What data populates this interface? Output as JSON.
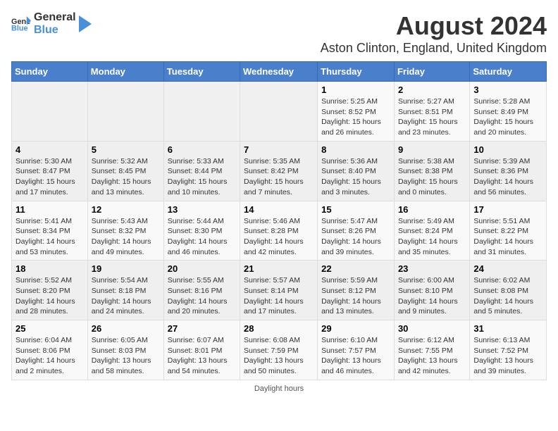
{
  "logo": {
    "text_general": "General",
    "text_blue": "Blue",
    "icon_symbol": "▶"
  },
  "title": "August 2024",
  "subtitle": "Aston Clinton, England, United Kingdom",
  "days_of_week": [
    "Sunday",
    "Monday",
    "Tuesday",
    "Wednesday",
    "Thursday",
    "Friday",
    "Saturday"
  ],
  "weeks": [
    [
      {
        "day": "",
        "info": ""
      },
      {
        "day": "",
        "info": ""
      },
      {
        "day": "",
        "info": ""
      },
      {
        "day": "",
        "info": ""
      },
      {
        "day": "1",
        "info": "Sunrise: 5:25 AM\nSunset: 8:52 PM\nDaylight: 15 hours and 26 minutes."
      },
      {
        "day": "2",
        "info": "Sunrise: 5:27 AM\nSunset: 8:51 PM\nDaylight: 15 hours and 23 minutes."
      },
      {
        "day": "3",
        "info": "Sunrise: 5:28 AM\nSunset: 8:49 PM\nDaylight: 15 hours and 20 minutes."
      }
    ],
    [
      {
        "day": "4",
        "info": "Sunrise: 5:30 AM\nSunset: 8:47 PM\nDaylight: 15 hours and 17 minutes."
      },
      {
        "day": "5",
        "info": "Sunrise: 5:32 AM\nSunset: 8:45 PM\nDaylight: 15 hours and 13 minutes."
      },
      {
        "day": "6",
        "info": "Sunrise: 5:33 AM\nSunset: 8:44 PM\nDaylight: 15 hours and 10 minutes."
      },
      {
        "day": "7",
        "info": "Sunrise: 5:35 AM\nSunset: 8:42 PM\nDaylight: 15 hours and 7 minutes."
      },
      {
        "day": "8",
        "info": "Sunrise: 5:36 AM\nSunset: 8:40 PM\nDaylight: 15 hours and 3 minutes."
      },
      {
        "day": "9",
        "info": "Sunrise: 5:38 AM\nSunset: 8:38 PM\nDaylight: 15 hours and 0 minutes."
      },
      {
        "day": "10",
        "info": "Sunrise: 5:39 AM\nSunset: 8:36 PM\nDaylight: 14 hours and 56 minutes."
      }
    ],
    [
      {
        "day": "11",
        "info": "Sunrise: 5:41 AM\nSunset: 8:34 PM\nDaylight: 14 hours and 53 minutes."
      },
      {
        "day": "12",
        "info": "Sunrise: 5:43 AM\nSunset: 8:32 PM\nDaylight: 14 hours and 49 minutes."
      },
      {
        "day": "13",
        "info": "Sunrise: 5:44 AM\nSunset: 8:30 PM\nDaylight: 14 hours and 46 minutes."
      },
      {
        "day": "14",
        "info": "Sunrise: 5:46 AM\nSunset: 8:28 PM\nDaylight: 14 hours and 42 minutes."
      },
      {
        "day": "15",
        "info": "Sunrise: 5:47 AM\nSunset: 8:26 PM\nDaylight: 14 hours and 39 minutes."
      },
      {
        "day": "16",
        "info": "Sunrise: 5:49 AM\nSunset: 8:24 PM\nDaylight: 14 hours and 35 minutes."
      },
      {
        "day": "17",
        "info": "Sunrise: 5:51 AM\nSunset: 8:22 PM\nDaylight: 14 hours and 31 minutes."
      }
    ],
    [
      {
        "day": "18",
        "info": "Sunrise: 5:52 AM\nSunset: 8:20 PM\nDaylight: 14 hours and 28 minutes."
      },
      {
        "day": "19",
        "info": "Sunrise: 5:54 AM\nSunset: 8:18 PM\nDaylight: 14 hours and 24 minutes."
      },
      {
        "day": "20",
        "info": "Sunrise: 5:55 AM\nSunset: 8:16 PM\nDaylight: 14 hours and 20 minutes."
      },
      {
        "day": "21",
        "info": "Sunrise: 5:57 AM\nSunset: 8:14 PM\nDaylight: 14 hours and 17 minutes."
      },
      {
        "day": "22",
        "info": "Sunrise: 5:59 AM\nSunset: 8:12 PM\nDaylight: 14 hours and 13 minutes."
      },
      {
        "day": "23",
        "info": "Sunrise: 6:00 AM\nSunset: 8:10 PM\nDaylight: 14 hours and 9 minutes."
      },
      {
        "day": "24",
        "info": "Sunrise: 6:02 AM\nSunset: 8:08 PM\nDaylight: 14 hours and 5 minutes."
      }
    ],
    [
      {
        "day": "25",
        "info": "Sunrise: 6:04 AM\nSunset: 8:06 PM\nDaylight: 14 hours and 2 minutes."
      },
      {
        "day": "26",
        "info": "Sunrise: 6:05 AM\nSunset: 8:03 PM\nDaylight: 13 hours and 58 minutes."
      },
      {
        "day": "27",
        "info": "Sunrise: 6:07 AM\nSunset: 8:01 PM\nDaylight: 13 hours and 54 minutes."
      },
      {
        "day": "28",
        "info": "Sunrise: 6:08 AM\nSunset: 7:59 PM\nDaylight: 13 hours and 50 minutes."
      },
      {
        "day": "29",
        "info": "Sunrise: 6:10 AM\nSunset: 7:57 PM\nDaylight: 13 hours and 46 minutes."
      },
      {
        "day": "30",
        "info": "Sunrise: 6:12 AM\nSunset: 7:55 PM\nDaylight: 13 hours and 42 minutes."
      },
      {
        "day": "31",
        "info": "Sunrise: 6:13 AM\nSunset: 7:52 PM\nDaylight: 13 hours and 39 minutes."
      }
    ]
  ],
  "footer": "Daylight hours"
}
